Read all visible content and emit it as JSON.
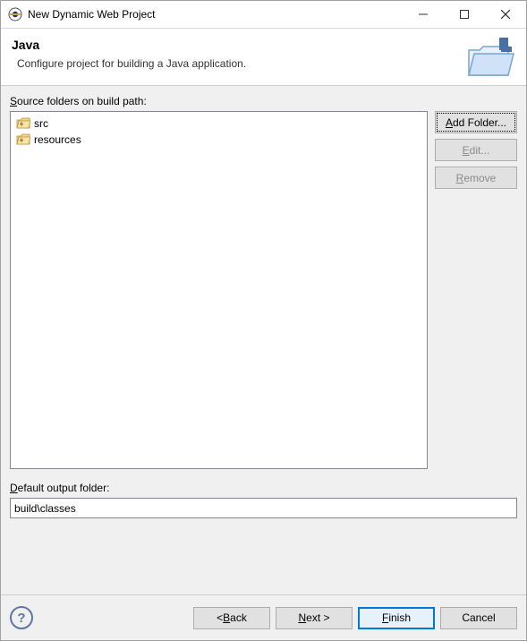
{
  "titlebar": {
    "title": "New Dynamic Web Project"
  },
  "header": {
    "title": "Java",
    "subtitle": "Configure project for building a Java application."
  },
  "sourceFolders": {
    "label_pre": "S",
    "label_rest": "ource folders on build path:",
    "items": [
      "src",
      "resources"
    ]
  },
  "sideButtons": {
    "add_pre": "A",
    "add_rest": "dd Folder...",
    "edit_pre": "E",
    "edit_rest": "dit...",
    "remove_pre": "R",
    "remove_rest": "emove"
  },
  "output": {
    "label_pre": "D",
    "label_rest": "efault output folder:",
    "value": "build\\classes"
  },
  "footer": {
    "back_pre": "B",
    "back_rest": "ack",
    "next_pre": "N",
    "next_rest": "ext >",
    "finish_pre": "F",
    "finish_rest": "inish",
    "cancel": "Cancel"
  }
}
